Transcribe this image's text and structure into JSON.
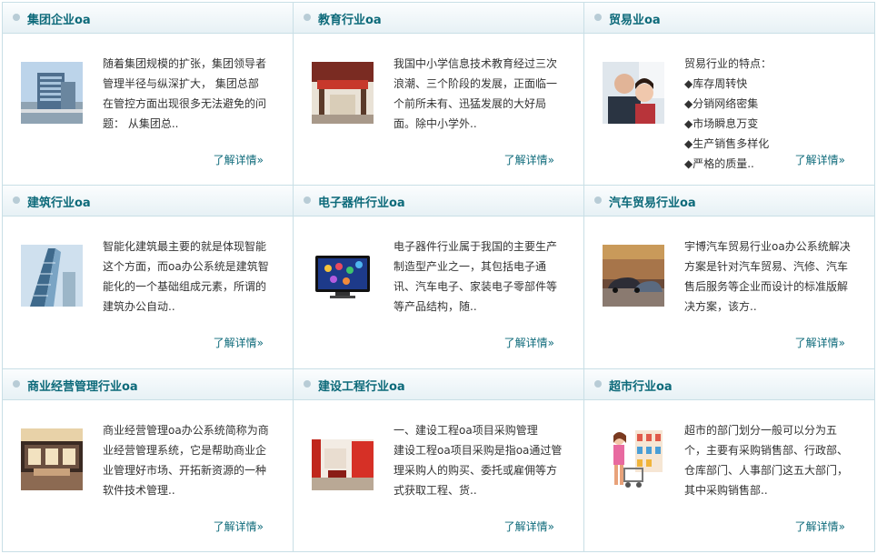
{
  "more_label": "了解详情»",
  "industries": [
    {
      "title": "集团企业oa",
      "icon": "office-building-photo",
      "lines": [
        "随着集团规模的扩张，集团领导者",
        "管理半径与纵深扩大，   集团总部",
        "在管控方面出现很多无法避免的问",
        "题：    从集团总.."
      ]
    },
    {
      "title": "教育行业oa",
      "icon": "school-gate-photo",
      "lines": [
        "我国中小学信息技术教育经过三次",
        "浪潮、三个阶段的发展，正面临一",
        "个前所未有、迅猛发展的大好局",
        "面。除中小学外.."
      ]
    },
    {
      "title": "贸易业oa",
      "icon": "business-people-photo",
      "lines": [
        "贸易行业的特点：",
        "◆库存周转快",
        "◆分销网络密集",
        "◆市场瞬息万变",
        "◆生产销售多样化",
        "◆严格的质量.."
      ]
    },
    {
      "title": "建筑行业oa",
      "icon": "skyscraper-photo",
      "lines": [
        "智能化建筑最主要的就是体现智能",
        "这个方面，而oa办公系统是建筑智",
        "能化的一个基础组成元素，所谓的",
        "建筑办公自动.."
      ]
    },
    {
      "title": "电子器件行业oa",
      "icon": "tv-screen-photo",
      "lines": [
        "电子器件行业属于我国的主要生产",
        "制造型产业之一，其包括电子通",
        "讯、汽车电子、家装电子零部件等",
        "等产品结构，随.."
      ]
    },
    {
      "title": "汽车贸易行业oa",
      "icon": "car-showroom-photo",
      "lines": [
        "宇博汽车贸易行业oa办公系统解决",
        "方案是针对汽车贸易、汽修、汽车",
        "售后服务等企业而设计的标准版解",
        "决方案，该方.."
      ]
    },
    {
      "title": "商业经营管理行业oa",
      "icon": "store-interior-photo",
      "lines": [
        "商业经营管理oa办公系统简称为商",
        "业经营管理系统，它是帮助商业企",
        "业管理好市场、开拓新资源的一种",
        "软件技术管理.."
      ]
    },
    {
      "title": "建设工程行业oa",
      "icon": "red-interior-photo",
      "lines": [
        "一、建设工程oa项目采购管理",
        "建设工程oa项目采购是指oa通过管",
        "理采购人的购买、委托或雇佣等方",
        "式获取工程、货.."
      ]
    },
    {
      "title": "超市行业oa",
      "icon": "supermarket-shopper-illustration",
      "lines": [
        "超市的部门划分一般可以分为五",
        "个，主要有采购销售部、行政部、",
        "仓库部门、人事部门这五大部门，",
        "其中采购销售部.."
      ]
    }
  ]
}
